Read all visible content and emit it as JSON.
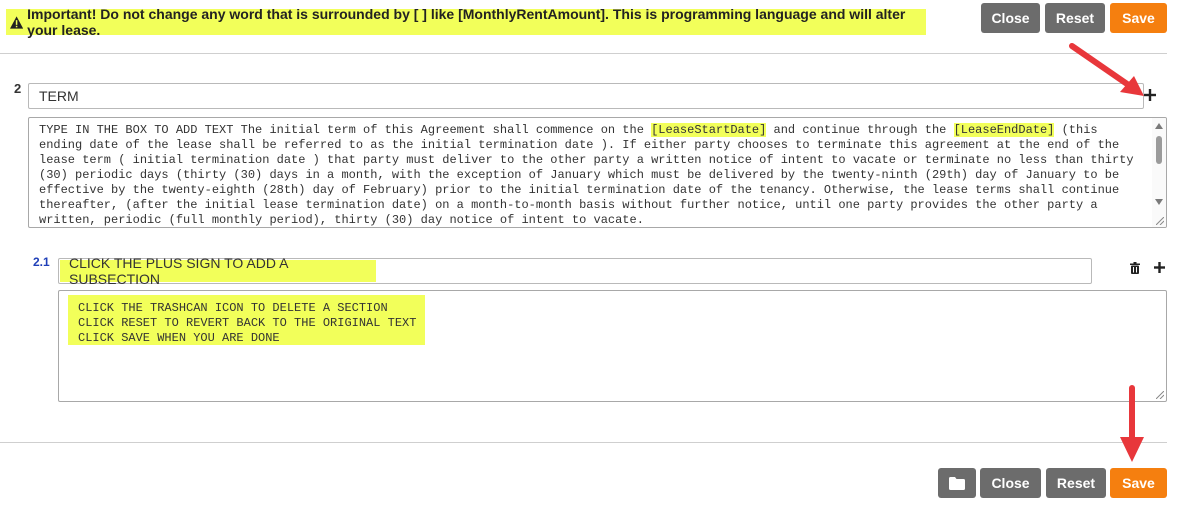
{
  "warning": {
    "text": "Important! Do not change any word that is surrounded by [ ] like [MonthlyRentAmount]. This is programming language and will alter your lease.",
    "icon": "warning-icon"
  },
  "top_toolbar": {
    "close_label": "Close",
    "reset_label": "Reset",
    "save_label": "Save"
  },
  "section": {
    "number": "2",
    "title_value": "TERM",
    "body_parts": [
      "TYPE IN THE BOX TO ADD TEXT The initial term of this Agreement shall commence on the ",
      "[LeaseStartDate]",
      " and continue through the ",
      "[LeaseEndDate]",
      " (this ending date of the lease shall be referred to as the  initial termination date ). If either party chooses to terminate this agreement at the end of the lease term ( initial termination date ) that party must deliver to the other party a written notice of intent to vacate or terminate no less than thirty (30) periodic days (thirty (30) days in a month, with the exception of January which must be delivered by the twenty-ninth (29th) day of January to be effective by the twenty-eighth (28th) day of February) prior to the initial termination date of the tenancy. Otherwise, the lease terms shall continue thereafter, (after the initial lease termination date) on a month-to-month basis without further notice, until one party provides the other party a written, periodic (full monthly period), thirty (30) day notice of intent to vacate."
    ]
  },
  "subsection": {
    "number": "2.1",
    "title_value": "CLICK THE PLUS SIGN TO ADD A SUBSECTION",
    "body": "CLICK THE TRASHCAN ICON TO DELETE A SECTION\nCLICK RESET TO REVERT BACK TO THE ORIGINAL TEXT\nCLICK SAVE WHEN YOU ARE DONE"
  },
  "bottom_toolbar": {
    "folder_icon": "folder-icon",
    "close_label": "Close",
    "reset_label": "Reset",
    "save_label": "Save"
  },
  "colors": {
    "highlight": "#f2ff5a",
    "button_gray": "#6c6c6c",
    "button_orange": "#f57f0f",
    "arrow_red": "#e8373b",
    "subsection_number": "#1f3fb8"
  }
}
